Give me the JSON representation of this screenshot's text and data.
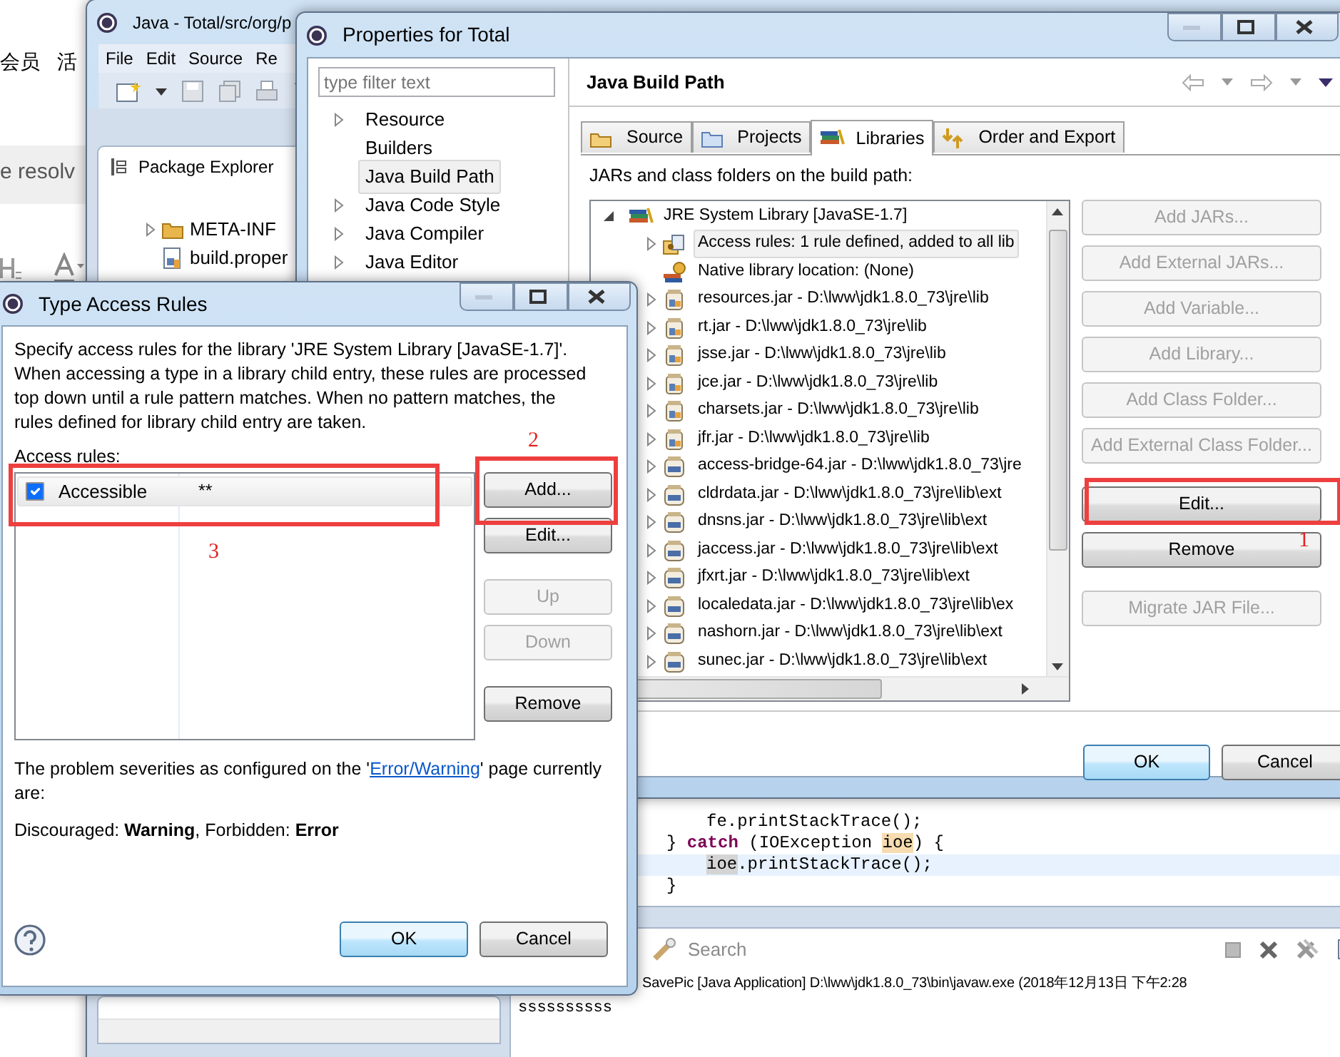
{
  "background_page": {
    "menu": [
      "会员",
      "活"
    ],
    "heading": "e resolv"
  },
  "eclipse": {
    "title": "Java - Total/src/org/p",
    "menu": [
      "File",
      "Edit",
      "Source",
      "Re"
    ],
    "package_explorer": {
      "title": "Package Explorer",
      "items": [
        {
          "label": "META-INF",
          "kind": "folder",
          "expanded": false
        },
        {
          "label": "build.proper",
          "kind": "file"
        }
      ]
    },
    "code_lines": [
      {
        "kind": "inner",
        "current": false,
        "tokens": [
          {
            "text": "fe.printStackTrace();",
            "kind": "plain"
          }
        ]
      },
      {
        "kind": "outer",
        "current": false,
        "tokens": [
          {
            "text": "} ",
            "kind": "plain"
          },
          {
            "text": "catch",
            "kind": "keyword"
          },
          {
            "text": " (IOException ",
            "kind": "plain"
          },
          {
            "text": "ioe",
            "kind": "write"
          },
          {
            "text": ") {",
            "kind": "plain"
          }
        ]
      },
      {
        "kind": "inner",
        "current": true,
        "tokens": [
          {
            "text": "ioe",
            "kind": "read"
          },
          {
            "text": ".printStackTrace();",
            "kind": "plain"
          }
        ]
      },
      {
        "kind": "outer",
        "current": false,
        "tokens": [
          {
            "text": "}",
            "kind": "plain"
          }
        ]
      }
    ],
    "console": {
      "tab": "Search",
      "launch": "SavePic [Java Application] D:\\lww\\jdk1.8.0_73\\bin\\javaw.exe (2018年12月13日 下午2:28",
      "output": "ssssssssss"
    }
  },
  "properties": {
    "title": "Properties for Total",
    "filter_placeholder": "type filter text",
    "nav": [
      {
        "label": "Resource",
        "expanded": false,
        "selected": false
      },
      {
        "label": "Builders",
        "selected": false
      },
      {
        "label": "Java Build Path",
        "selected": true
      },
      {
        "label": "Java Code Style",
        "expanded": false,
        "selected": false
      },
      {
        "label": "Java Compiler",
        "expanded": false,
        "selected": false
      },
      {
        "label": "Java Editor",
        "expanded": false,
        "selected": false
      }
    ],
    "page_title": "Java Build Path",
    "tabs": [
      {
        "label": "Source",
        "kind": "source",
        "selected": false
      },
      {
        "label": "Projects",
        "kind": "projects",
        "selected": false
      },
      {
        "label": "Libraries",
        "kind": "libraries",
        "selected": true
      },
      {
        "label": "Order and Export",
        "kind": "order",
        "selected": false
      }
    ],
    "list_label": "JARs and class folders on the build path:",
    "tree": {
      "label": "JRE System Library [JavaSE-1.7]",
      "kind": "library",
      "expanded": true,
      "selected": false,
      "children": [
        {
          "label": "Access rules: 1 rule defined, added to all lib",
          "kind": "rules",
          "expanded": false,
          "selected": true
        },
        {
          "label": "Native library location: (None)",
          "kind": "native",
          "selected": false
        },
        {
          "label": "resources.jar - D:\\lww\\jdk1.8.0_73\\jre\\lib",
          "kind": "jar",
          "expanded": false,
          "selected": false
        },
        {
          "label": "rt.jar - D:\\lww\\jdk1.8.0_73\\jre\\lib",
          "kind": "jar",
          "expanded": false,
          "selected": false
        },
        {
          "label": "jsse.jar - D:\\lww\\jdk1.8.0_73\\jre\\lib",
          "kind": "jar",
          "expanded": false,
          "selected": false
        },
        {
          "label": "jce.jar - D:\\lww\\jdk1.8.0_73\\jre\\lib",
          "kind": "jar",
          "expanded": false,
          "selected": false
        },
        {
          "label": "charsets.jar - D:\\lww\\jdk1.8.0_73\\jre\\lib",
          "kind": "jar",
          "expanded": false,
          "selected": false
        },
        {
          "label": "jfr.jar - D:\\lww\\jdk1.8.0_73\\jre\\lib",
          "kind": "jar",
          "expanded": false,
          "selected": false
        },
        {
          "label": "access-bridge-64.jar - D:\\lww\\jdk1.8.0_73\\jre",
          "kind": "ext",
          "expanded": false,
          "selected": false
        },
        {
          "label": "cldrdata.jar - D:\\lww\\jdk1.8.0_73\\jre\\lib\\ext",
          "kind": "ext",
          "expanded": false,
          "selected": false
        },
        {
          "label": "dnsns.jar - D:\\lww\\jdk1.8.0_73\\jre\\lib\\ext",
          "kind": "ext",
          "expanded": false,
          "selected": false
        },
        {
          "label": "jaccess.jar - D:\\lww\\jdk1.8.0_73\\jre\\lib\\ext",
          "kind": "ext",
          "expanded": false,
          "selected": false
        },
        {
          "label": "jfxrt.jar - D:\\lww\\jdk1.8.0_73\\jre\\lib\\ext",
          "kind": "ext",
          "expanded": false,
          "selected": false
        },
        {
          "label": "localedata.jar - D:\\lww\\jdk1.8.0_73\\jre\\lib\\ex",
          "kind": "ext",
          "expanded": false,
          "selected": false
        },
        {
          "label": "nashorn.jar - D:\\lww\\jdk1.8.0_73\\jre\\lib\\ext",
          "kind": "ext",
          "expanded": false,
          "selected": false
        },
        {
          "label": "sunec.jar - D:\\lww\\jdk1.8.0_73\\jre\\lib\\ext",
          "kind": "ext",
          "expanded": false,
          "selected": false
        }
      ]
    },
    "buttons": [
      {
        "label": "Add JARs...",
        "disabled": true
      },
      {
        "label": "Add External JARs...",
        "disabled": true
      },
      {
        "label": "Add Variable...",
        "disabled": true
      },
      {
        "label": "Add Library...",
        "disabled": true
      },
      {
        "label": "Add Class Folder...",
        "disabled": true
      },
      {
        "label": "Add External Class Folder...",
        "disabled": true
      },
      {
        "label": "Edit...",
        "disabled": false
      },
      {
        "label": "Remove",
        "disabled": false
      },
      {
        "label": "Migrate JAR File...",
        "disabled": true
      }
    ],
    "footer_buttons": [
      {
        "label": "OK",
        "default": true
      },
      {
        "label": "Cancel",
        "default": false
      }
    ]
  },
  "type_access_rules": {
    "title": "Type Access Rules",
    "description": "Specify access rules for the library 'JRE System Library [JavaSE-1.7]'. When accessing a type in a library child entry, these rules are processed top down until a rule pattern matches. When no pattern matches, the rules defined for library child entry are taken.",
    "rules_label": "Access rules:",
    "rules": [
      {
        "kind": "Accessible",
        "pattern": "**",
        "checked": true
      }
    ],
    "buttons": [
      {
        "label": "Add...",
        "disabled": false
      },
      {
        "label": "Edit...",
        "disabled": false
      },
      {
        "label": "Up",
        "disabled": true
      },
      {
        "label": "Down",
        "disabled": true
      },
      {
        "label": "Remove",
        "disabled": false
      }
    ],
    "severities": {
      "before": "The problem severities as configured on the '",
      "link": "Error/Warning",
      "after": "' page currently are:"
    },
    "current": "Discouraged: **Warning**, Forbidden: **Error**",
    "footer_buttons": [
      {
        "label": "OK",
        "default": true
      },
      {
        "label": "Cancel",
        "default": false
      }
    ]
  },
  "annotations": [
    {
      "label": "1"
    },
    {
      "label": "2"
    },
    {
      "label": "3"
    }
  ]
}
